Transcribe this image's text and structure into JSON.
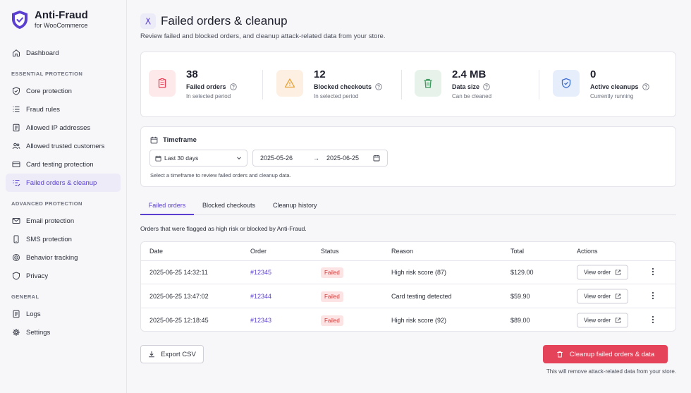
{
  "brand": {
    "title": "Anti-Fraud",
    "subtitle": "for WooCommerce"
  },
  "sidebar": {
    "dashboard": "Dashboard",
    "sections": [
      {
        "title": "ESSENTIAL PROTECTION",
        "items": [
          "Core protection",
          "Fraud rules",
          "Allowed IP addresses",
          "Allowed trusted customers",
          "Card testing protection",
          "Failed orders & cleanup"
        ]
      },
      {
        "title": "ADVANCED PROTECTION",
        "items": [
          "Email protection",
          "SMS protection",
          "Behavior tracking",
          "Privacy"
        ]
      },
      {
        "title": "GENERAL",
        "items": [
          "Logs",
          "Settings"
        ]
      }
    ]
  },
  "page": {
    "title": "Failed orders & cleanup",
    "description": "Review failed and blocked orders, and cleanup attack-related data from your store."
  },
  "stats": [
    {
      "value": "38",
      "label": "Failed orders",
      "sub": "In selected period"
    },
    {
      "value": "12",
      "label": "Blocked checkouts",
      "sub": "In selected period"
    },
    {
      "value": "2.4 MB",
      "label": "Data size",
      "sub": "Can be cleaned"
    },
    {
      "value": "0",
      "label": "Active cleanups",
      "sub": "Currently running"
    }
  ],
  "timeframe": {
    "label": "Timeframe",
    "selected": "Last 30 days",
    "start": "2025-05-26",
    "arrow": "→",
    "end": "2025-06-25",
    "help": "Select a timeframe to review failed orders and cleanup data."
  },
  "tabs": [
    "Failed orders",
    "Blocked checkouts",
    "Cleanup history"
  ],
  "table": {
    "description": "Orders that were flagged as high risk or blocked by Anti-Fraud.",
    "headers": [
      "Date",
      "Order",
      "Status",
      "Reason",
      "Total",
      "Actions"
    ],
    "rows": [
      {
        "date": "2025-06-25 14:32:11",
        "order": "#12345",
        "status": "Failed",
        "reason": "High risk score (87)",
        "total": "$129.00",
        "action": "View order"
      },
      {
        "date": "2025-06-25 13:47:02",
        "order": "#12344",
        "status": "Failed",
        "reason": "Card testing detected",
        "total": "$59.90",
        "action": "View order"
      },
      {
        "date": "2025-06-25 12:18:45",
        "order": "#12343",
        "status": "Failed",
        "reason": "High risk score (92)",
        "total": "$89.00",
        "action": "View order"
      }
    ]
  },
  "footer": {
    "export": "Export CSV",
    "cleanup": "Cleanup failed orders & data",
    "note": "This will remove attack-related data from your store."
  },
  "colors": {
    "accent": "#5b3fd1",
    "danger": "#e5435a",
    "warning": "#e8a33a",
    "success": "#3e9a5f",
    "info": "#3f6fd1"
  }
}
